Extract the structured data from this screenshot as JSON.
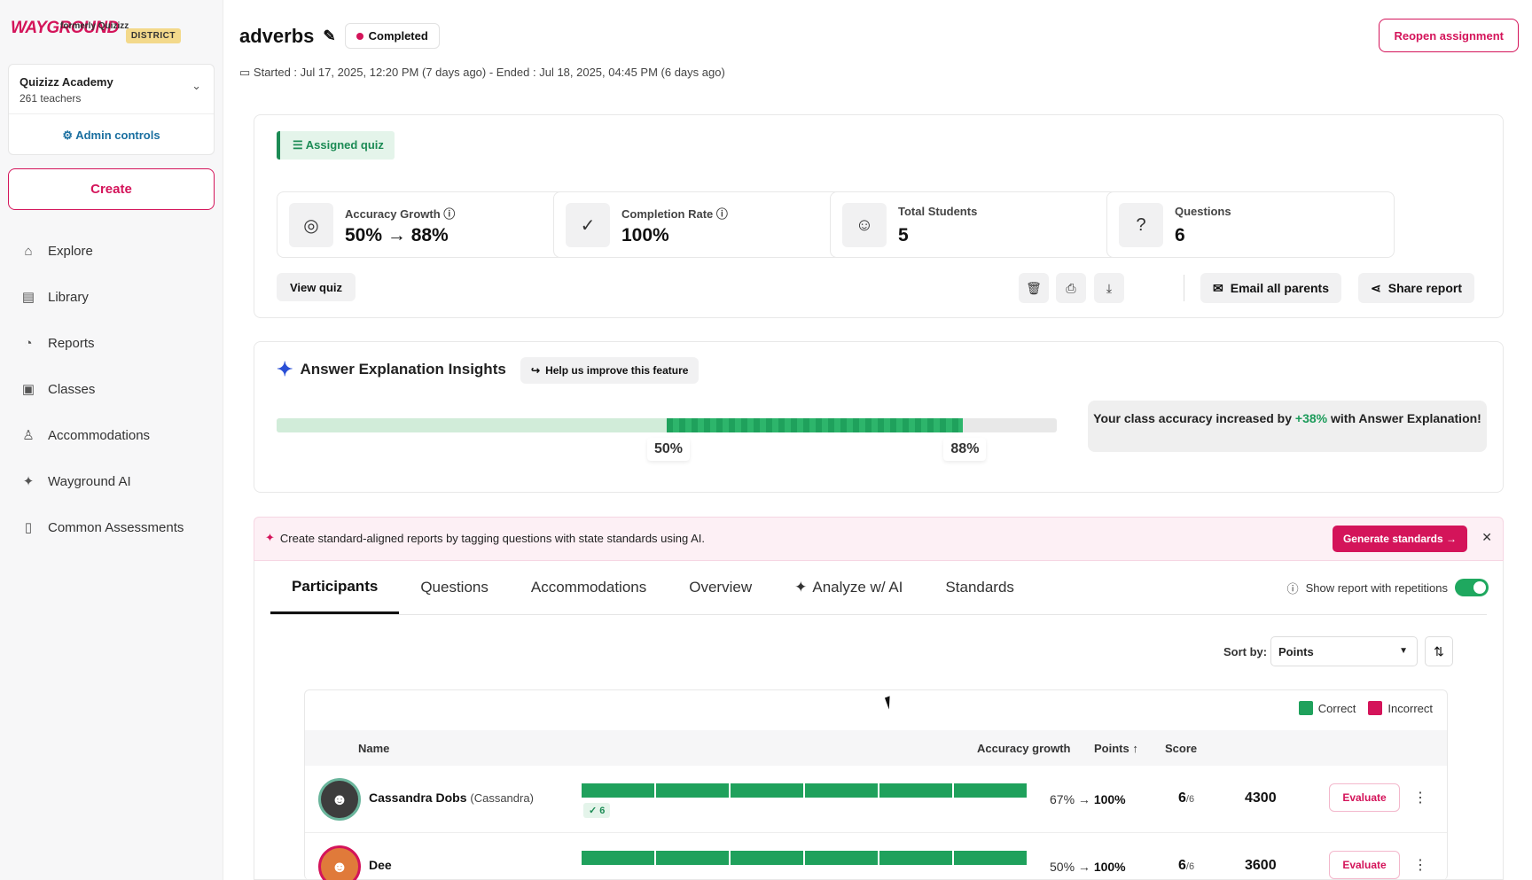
{
  "sidebar": {
    "logo": "WAYGROUND",
    "logo_sub": "formerly Quizizz",
    "district": "DISTRICT",
    "org_name": "Quizizz Academy",
    "org_sub": "261 teachers",
    "admin": "Admin controls",
    "create": "Create",
    "items": [
      {
        "label": "Explore",
        "icon": "home-icon"
      },
      {
        "label": "Library",
        "icon": "book-icon"
      },
      {
        "label": "Reports",
        "icon": "chart-icon"
      },
      {
        "label": "Classes",
        "icon": "classes-icon"
      },
      {
        "label": "Accommodations",
        "icon": "person-icon"
      },
      {
        "label": "Wayground AI",
        "icon": "sparkle-icon"
      },
      {
        "label": "Common Assessments",
        "icon": "clipboard-icon"
      }
    ]
  },
  "header": {
    "title": "adverbs",
    "status": "Completed",
    "dates": "Started : Jul 17, 2025, 12:20 PM (7 days ago) - Ended : Jul 18, 2025, 04:45 PM (6 days ago)",
    "reopen": "Reopen assignment"
  },
  "summary": {
    "tag": "Assigned quiz",
    "stats": [
      {
        "label": "Accuracy Growth",
        "value": "50% → 88%"
      },
      {
        "label": "Completion Rate",
        "value": "100%"
      },
      {
        "label": "Total Students",
        "value": "5"
      },
      {
        "label": "Questions",
        "value": "6"
      }
    ],
    "view_quiz": "View quiz",
    "email_parents": "Email all parents",
    "share_report": "Share report"
  },
  "insights": {
    "title": "Answer Explanation Insights",
    "help": "Help us improve this feature",
    "from": "50%",
    "to": "88%",
    "from_value": 0.5,
    "to_value": 0.88,
    "msg_pre": "Your class accuracy increased by ",
    "msg_delta": "+38%",
    "msg_post": " with Answer Explanation!"
  },
  "banner": {
    "text": "Create standard-aligned reports by tagging questions with state standards using AI.",
    "button": "Generate standards →"
  },
  "tabs": [
    "Participants",
    "Questions",
    "Accommodations",
    "Overview",
    "Analyze w/ AI",
    "Standards"
  ],
  "report_toggle": "Show report with repetitions",
  "sort": {
    "label": "Sort by:",
    "value": "Points"
  },
  "legend": {
    "correct": "Correct",
    "incorrect": "Incorrect",
    "correct_color": "#1fa15c",
    "incorrect_color": "#d4145a"
  },
  "table": {
    "headers": {
      "name": "Name",
      "accuracy": "Accuracy growth",
      "points": "Points",
      "score": "Score"
    },
    "rows": [
      {
        "name": "Cassandra Dobs",
        "alias": "(Cassandra)",
        "correct": "6",
        "acc_from": "67%",
        "acc_to": "100%",
        "points": "6",
        "total": "/6",
        "score": "4300",
        "evaluate": "Evaluate"
      },
      {
        "name": "Dee",
        "alias": "",
        "correct": "",
        "acc_from": "50%",
        "acc_to": "100%",
        "points": "6",
        "total": "/6",
        "score": "3600",
        "evaluate": "Evaluate"
      }
    ]
  }
}
